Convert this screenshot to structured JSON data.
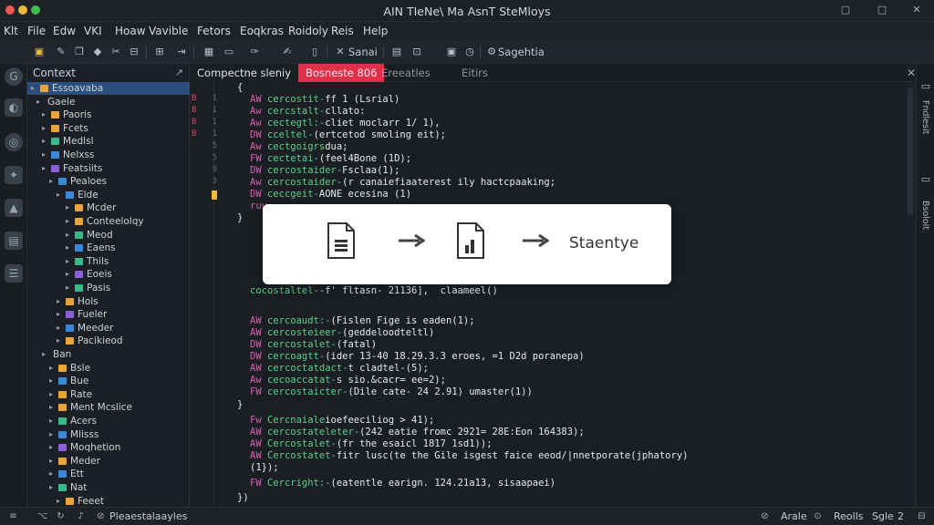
{
  "window": {
    "title": "AIN TIeNe\\ Ma AsnT SteMloys",
    "controls": [
      "restore-icon",
      "maximize-icon",
      "close-icon"
    ]
  },
  "menu": [
    "Klt",
    "File",
    "Edw",
    "VKI",
    "Hoaw",
    "Vavible",
    "Fetors",
    "Eoqkras",
    "Roidoly",
    "Reis",
    "Help"
  ],
  "toolbar": {
    "icons": [
      "save-icon",
      "edit-icon",
      "copy-icon",
      "diamond-icon",
      "clip-icon",
      "split-icon",
      "tag-icon",
      "indent-icon",
      "grid-icon",
      "brush-icon",
      "puzzle-icon",
      "book-icon",
      "window-icon",
      "grid2-icon",
      "copy2-icon",
      "clock-icon"
    ],
    "labels": {
      "sync": "Sanai",
      "settings": "Sagehtia"
    }
  },
  "sidebar": {
    "title": "Context",
    "items": [
      {
        "label": "Essoavaba",
        "color": "#e8a53a"
      },
      {
        "label": "Gaele",
        "color": ""
      },
      {
        "label": "Paoris",
        "color": "#e8a53a"
      },
      {
        "label": "Fcets",
        "color": "#e8a53a"
      },
      {
        "label": "Medlsl",
        "color": "#3ab88a"
      },
      {
        "label": "Nelxss",
        "color": "#3a8ad8"
      },
      {
        "label": "Featsiits",
        "color": "#8a5fd8"
      },
      {
        "label": "Pealoes",
        "color": "#3a8ad8"
      },
      {
        "label": "Elde",
        "color": "#3a8ad8"
      },
      {
        "label": "Mcder",
        "color": "#e8a53a"
      },
      {
        "label": "Conteelolqy",
        "color": "#e8a53a"
      },
      {
        "label": "Meod",
        "color": "#3ab88a"
      },
      {
        "label": "Eaens",
        "color": "#3a8ad8"
      },
      {
        "label": "Thils",
        "color": "#3ab88a"
      },
      {
        "label": "Eoeis",
        "color": "#8a5fd8"
      },
      {
        "label": "Pasis",
        "color": "#3ab88a"
      },
      {
        "label": "Hols",
        "color": "#e8a53a"
      },
      {
        "label": "Fueler",
        "color": "#8a5fd8"
      },
      {
        "label": "Meeder",
        "color": "#3a8ad8"
      },
      {
        "label": "Pacikieod",
        "color": "#e8a53a"
      },
      {
        "label": "Ban",
        "color": ""
      },
      {
        "label": "Bsle",
        "color": "#e8a53a"
      },
      {
        "label": "Bue",
        "color": "#3a8ad8"
      },
      {
        "label": "Rate",
        "color": "#e8a53a"
      },
      {
        "label": "Ment Mcslice",
        "color": "#e8a53a"
      },
      {
        "label": "Acers",
        "color": "#3ab88a"
      },
      {
        "label": "Mlisss",
        "color": "#3a8ad8"
      },
      {
        "label": "Moqhetion",
        "color": "#8a5fd8"
      },
      {
        "label": "Meder",
        "color": "#e8a53a"
      },
      {
        "label": "Ett",
        "color": "#3a8ad8"
      },
      {
        "label": "Nat",
        "color": "#3ab88a"
      },
      {
        "label": "Feeet",
        "color": "#e8a53a"
      }
    ]
  },
  "tabs": [
    {
      "label": "Compectne sleniy",
      "state": "active"
    },
    {
      "label": "Bosneste 806",
      "state": "error"
    },
    {
      "label": "Ereeatles",
      "state": "normal"
    },
    {
      "label": "Eitirs",
      "state": "normal"
    }
  ],
  "code": [
    {
      "mark": "",
      "num": "",
      "kw": "",
      "fn": "",
      "text": "{"
    },
    {
      "mark": "",
      "num": "1",
      "kw": "AW",
      "fn": "cercostit-",
      "text": "ff 1 (Lsrial)"
    },
    {
      "mark": "",
      "num": "1",
      "kw": "Aw",
      "fn": "cercstalt-",
      "text": "cllato:"
    },
    {
      "mark": "",
      "num": "1",
      "kw": "Aw",
      "fn": "cectegtl:-",
      "text": "cliet moclarr 1/ 1),"
    },
    {
      "mark": "",
      "num": "1",
      "kw": "DW",
      "fn": "cceltel-",
      "text": "(ertcetod smoling eit);"
    },
    {
      "mark": "",
      "num": "",
      "kw": "Aw",
      "fn": "cectgoigrs",
      "text": "dua;"
    },
    {
      "mark": "",
      "num": "",
      "kw": "FW",
      "fn": "cectetai-",
      "text": "(feel4Bone (1D);"
    },
    {
      "mark": "",
      "num": "",
      "kw": "DW",
      "fn": "cercostaider-",
      "text": "Fsclaa(1);"
    },
    {
      "mark": "",
      "num": "",
      "kw": "Aw",
      "fn": "cercostaider-",
      "text": "(r canaiefiaaterest ily hactcpaaking;"
    },
    {
      "mark": "",
      "num": "",
      "kw": "DW",
      "fn": "ceccgeit-",
      "text": "AONE ecesina (1)"
    },
    {
      "mark": "",
      "num": "",
      "kw": "ruu",
      "fn": "",
      "text": ""
    },
    {
      "mark": "",
      "num": "",
      "kw": "",
      "fn": "",
      "text": "}"
    },
    {
      "mark": "",
      "num": "",
      "kw": "",
      "fn": "cocostaltel-",
      "text": "-f' fltasn- 21136],  claameel()"
    },
    {
      "mark": "",
      "num": "",
      "kw": "AW",
      "fn": "cercoaudt:-",
      "text": "(Fislen Fige is eaden(1);"
    },
    {
      "mark": "",
      "num": "",
      "kw": "AW",
      "fn": "cercosteieer-",
      "text": "(geddeloodteltl)"
    },
    {
      "mark": "",
      "num": "",
      "kw": "DW",
      "fn": "cercostalet-",
      "text": "(fatal)"
    },
    {
      "mark": "",
      "num": "",
      "kw": "DW",
      "fn": "cercoagtt-",
      "text": "(ider 13-40 18.29.3.3 eroes, =1 D2d poranepa)"
    },
    {
      "mark": "",
      "num": "",
      "kw": "AW",
      "fn": "cercoctatdact-",
      "text": "t cladtel-(5);"
    },
    {
      "mark": "",
      "num": "",
      "kw": "Aw",
      "fn": "cecoaccatat-",
      "text": "s sio.&cacr= ee=2);"
    },
    {
      "mark": "",
      "num": "",
      "kw": "FW",
      "fn": "cercostaicter-",
      "text": "(Dile cate- 24 2.91) umaster(1))"
    },
    {
      "mark": "",
      "num": "",
      "kw": "",
      "fn": "",
      "text": "}"
    },
    {
      "mark": "",
      "num": "",
      "kw": "Fw",
      "fn": "Cercnaiale",
      "text": "ioefeeciliog > 41);"
    },
    {
      "mark": "",
      "num": "",
      "kw": "AW",
      "fn": "cercostateleter-",
      "text": "(242 eatie fromc 2921= 28E:Eon 164383);"
    },
    {
      "mark": "",
      "num": "",
      "kw": "AW",
      "fn": "Cercostalet-",
      "text": "(fr the esaicl 1817 1sd1));"
    },
    {
      "mark": "",
      "num": "",
      "kw": "AW",
      "fn": "Cercostatet-",
      "text": "fitr lusc(te the Gile isgest faice eeod/|nnetporate(jphatory)"
    },
    {
      "mark": "",
      "num": "",
      "kw": "",
      "fn": "",
      "text": "(1});"
    },
    {
      "mark": "",
      "num": "",
      "kw": "FW",
      "fn": "Cercright:-",
      "text": "(eatentle earign. 124.21a13, sisaapaei)"
    },
    {
      "mark": "",
      "num": "",
      "kw": "",
      "fn": "",
      "text": "})"
    }
  ],
  "gutter_marks": [
    {
      "row": 1,
      "mark": "B",
      "num": "1"
    },
    {
      "row": 2,
      "mark": "B",
      "num": "1"
    },
    {
      "row": 3,
      "mark": "B",
      "num": "1"
    },
    {
      "row": 4,
      "mark": "B",
      "num": "1"
    },
    {
      "row": 5,
      "mark": "",
      "num": "5"
    },
    {
      "row": 6,
      "mark": "",
      "num": "5"
    },
    {
      "row": 7,
      "mark": "",
      "num": "9"
    },
    {
      "row": 8,
      "mark": "",
      "num": "3"
    }
  ],
  "overlay": {
    "label": "Staentye"
  },
  "rightbar": [
    "Fndlesit",
    "Bsoloit"
  ],
  "status": {
    "left": "Pleaestalaayles",
    "right_items": [
      "Arale",
      "Reolls",
      "Sgle",
      "2"
    ]
  },
  "colors": {
    "keyword": "#d85fb0",
    "function": "#56d28a",
    "text": "#e7e9ec",
    "error_tab": "#e0304a",
    "selection": "#2b4e7e"
  }
}
